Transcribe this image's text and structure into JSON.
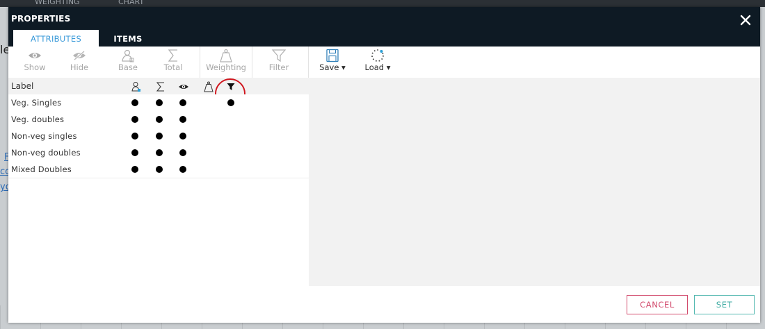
{
  "background": {
    "tabs": [
      "WEIGHTING",
      "CHART"
    ],
    "fragments": [
      "le"
    ],
    "links": [
      "F",
      "co",
      "yo"
    ]
  },
  "modal": {
    "title": "PROPERTIES",
    "tabs": [
      {
        "label": "ATTRIBUTES",
        "active": true
      },
      {
        "label": "ITEMS",
        "active": false
      }
    ]
  },
  "toolbar": {
    "show": "Show",
    "hide": "Hide",
    "base": "Base",
    "total": "Total",
    "weighting": "Weighting",
    "filter": "Filter",
    "save": "Save ▾",
    "load": "Load ▾"
  },
  "table": {
    "label_header": "Label",
    "column_icons": [
      "base-icon",
      "sum-icon",
      "eye-icon",
      "weight-icon",
      "filter-icon"
    ],
    "rows": [
      {
        "label": "Veg. Singles",
        "base": true,
        "total": true,
        "show": true,
        "weighting": false,
        "filter": true
      },
      {
        "label": "Veg. doubles",
        "base": true,
        "total": true,
        "show": true,
        "weighting": false,
        "filter": false
      },
      {
        "label": "Non-veg singles",
        "base": true,
        "total": true,
        "show": true,
        "weighting": false,
        "filter": false
      },
      {
        "label": "Non-veg doubles",
        "base": true,
        "total": true,
        "show": true,
        "weighting": false,
        "filter": false
      },
      {
        "label": "Mixed Doubles",
        "base": true,
        "total": true,
        "show": true,
        "weighting": false,
        "filter": false
      }
    ]
  },
  "footer": {
    "cancel": "CANCEL",
    "set": "SET"
  },
  "colors": {
    "header_bg": "#0e1a24",
    "tab_active_text": "#3a9ad9",
    "cancel": "#d24a6c",
    "set": "#3aa9a0",
    "highlight": "#d0161e"
  }
}
